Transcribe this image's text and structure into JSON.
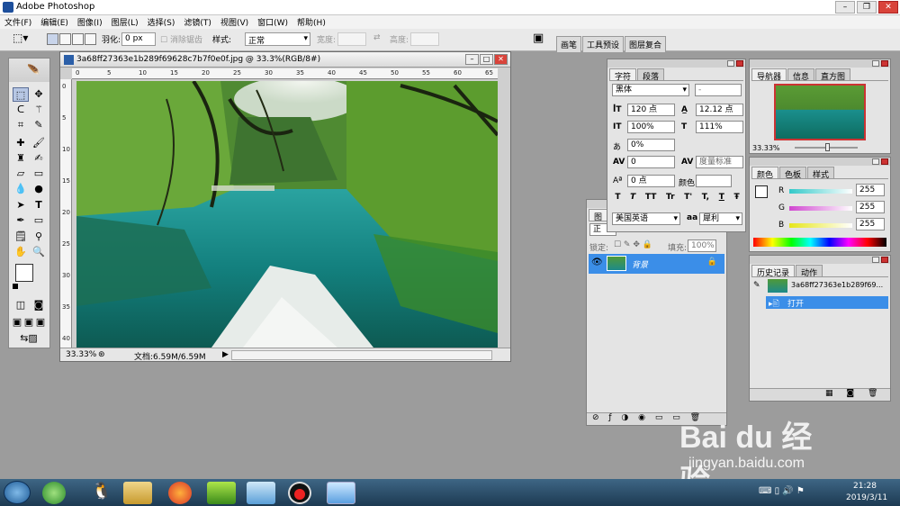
{
  "app": {
    "title": "Adobe Photoshop"
  },
  "menu": [
    "文件(F)",
    "编辑(E)",
    "图像(I)",
    "图层(L)",
    "选择(S)",
    "滤镜(T)",
    "视图(V)",
    "窗口(W)",
    "帮助(H)"
  ],
  "options": {
    "feather_label": "羽化:",
    "feather_value": "0 px",
    "antialias_label": "消除锯齿",
    "style_label": "样式:",
    "style_value": "正常",
    "width_label": "宽度:",
    "height_label": "高度:",
    "tabs": [
      "画笔",
      "工具预设",
      "图层复合"
    ]
  },
  "document": {
    "title": "3a68ff27363e1b289f69628c7b7f0e0f.jpg @ 33.3%(RGB/8#)",
    "zoom": "33.33%",
    "doc_info": "文档:6.59M/6.59M",
    "ruler_h": [
      "0",
      "5",
      "10",
      "15",
      "20",
      "25",
      "30",
      "35",
      "40",
      "45",
      "50",
      "55",
      "60",
      "65"
    ],
    "ruler_v": [
      "0",
      "5",
      "10",
      "15",
      "20",
      "25",
      "30",
      "35",
      "40"
    ]
  },
  "character_panel": {
    "tabs": [
      "字符",
      "段落"
    ],
    "font_family": "黑体",
    "font_style": "-",
    "font_size": "120 点",
    "leading": "12.12 点",
    "vertical_scale": "100%",
    "horizontal_scale": "111%",
    "baseline_pct": "0%",
    "tracking": "0",
    "kerning": "度量标准",
    "baseline_shift": "0 点",
    "color_label": "颜色:",
    "language": "美国英语",
    "aa_label": "aa",
    "antialias": "犀利",
    "style_buttons": [
      "T",
      "T",
      "TT",
      "Tr",
      "T'",
      "T,",
      "T",
      "Ŧ"
    ]
  },
  "layers_panel": {
    "tab": "图",
    "blend": "正",
    "lock_label": "锁定:",
    "fill_label": "填充:",
    "fill_value": "100%",
    "layer_name": "背景"
  },
  "navigator_panel": {
    "tabs": [
      "导航器",
      "信息",
      "直方图"
    ],
    "zoom": "33.33%"
  },
  "color_panel": {
    "tabs": [
      "颜色",
      "色板",
      "样式"
    ],
    "channels": [
      {
        "label": "R",
        "value": "255",
        "color": "#33c9c9"
      },
      {
        "label": "G",
        "value": "255",
        "color": "#d046d0"
      },
      {
        "label": "B",
        "value": "255",
        "color": "#e6e619"
      }
    ]
  },
  "history_panel": {
    "tabs": [
      "历史记录",
      "动作"
    ],
    "snapshot": "3a68ff27363e1b289f69...",
    "items": [
      "打开"
    ]
  },
  "taskbar": {
    "time": "21:28",
    "date": "2019/3/11"
  },
  "watermark": {
    "brand": "Bai du 经验",
    "url": "jingyan.baidu.com"
  }
}
